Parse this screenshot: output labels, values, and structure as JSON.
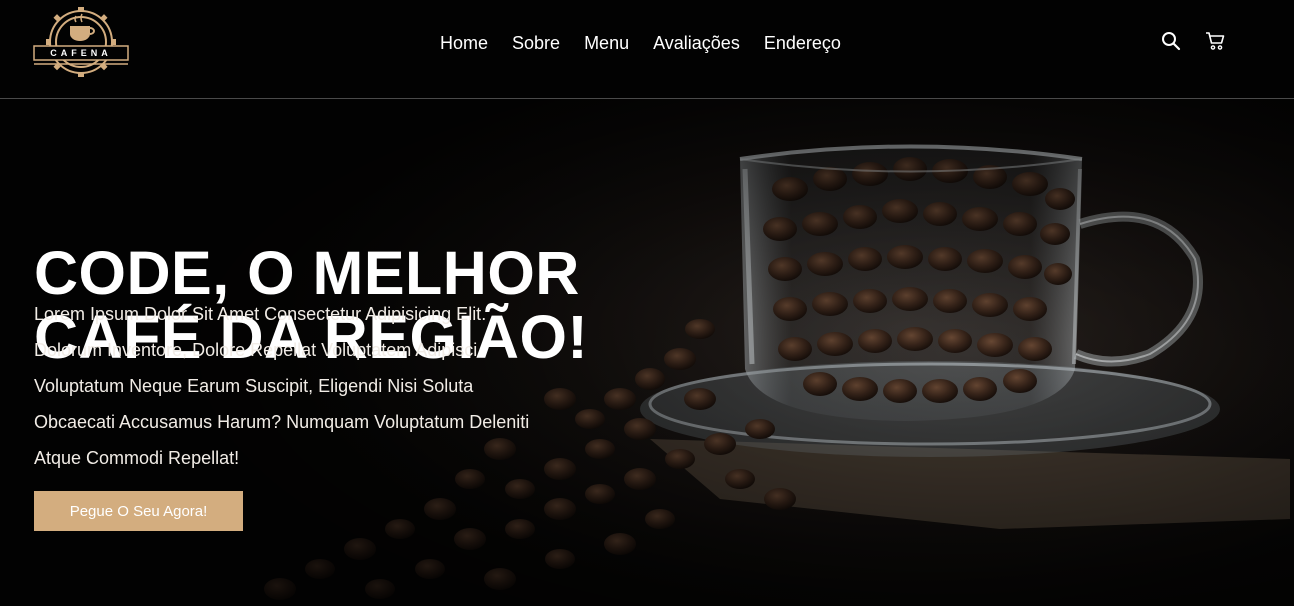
{
  "brand": {
    "logo_text": "CAFENA"
  },
  "nav": {
    "items": [
      {
        "label": "Home"
      },
      {
        "label": "Sobre"
      },
      {
        "label": "Menu"
      },
      {
        "label": "Avaliações"
      },
      {
        "label": "Endereço"
      }
    ]
  },
  "header_icons": {
    "search": "search-icon",
    "cart": "cart-icon"
  },
  "hero": {
    "title_line1": "CODE, O MELHOR",
    "title_line2": "CAFÉ DA REGIÃO!",
    "description": "Lorem Ipsum Dolor Sit Amet Consectetur Adipisicing Elit. Dolorum Inventore, Dolore Repellat Voluptatem Adipisci Voluptatum Neque Earum Suscipit, Eligendi Nisi Soluta Obcaecati Accusamus Harum? Numquam Voluptatum Deleniti Atque Commodi Repellat!",
    "cta_label": "Pegue O Seu Agora!"
  },
  "colors": {
    "accent": "#d3ad7f",
    "header_bg": "#020202",
    "text": "#ffffff"
  }
}
